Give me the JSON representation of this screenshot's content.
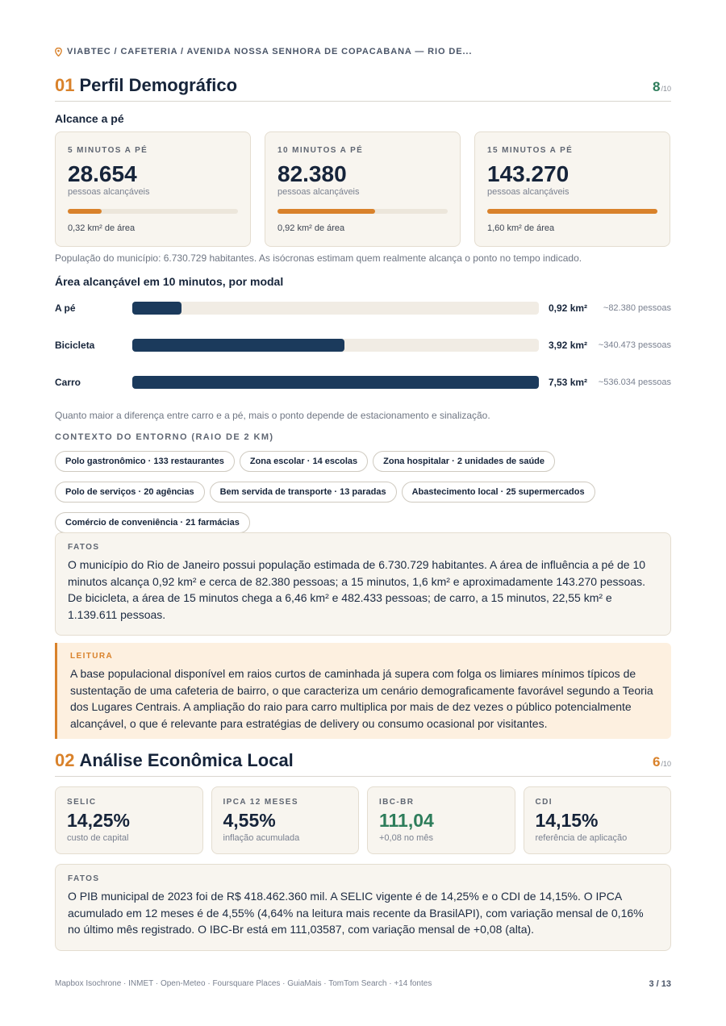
{
  "breadcrumb": "VIABTEC / CAFETERIA / AVENIDA NOSSA SENHORA DE COPACABANA — RIO DE...",
  "colors": {
    "accent": "#d9822b",
    "navy": "#1b3a5c",
    "green": "#2e7d5b"
  },
  "section1": {
    "number": "01",
    "title": "Perfil Demográfico",
    "score": "8",
    "score_den": "/10",
    "reach_title": "Alcance a pé",
    "reach_cards": [
      {
        "label": "5 MINUTOS A PÉ",
        "value": "28.654",
        "sub": "pessoas alcançáveis",
        "progress": 0.2,
        "area": "0,32 km² de área"
      },
      {
        "label": "10 MINUTOS A PÉ",
        "value": "82.380",
        "sub": "pessoas alcançáveis",
        "progress": 0.575,
        "area": "0,92 km² de área"
      },
      {
        "label": "15 MINUTOS A PÉ",
        "value": "143.270",
        "sub": "pessoas alcançáveis",
        "progress": 1.0,
        "area": "1,60 km² de área"
      }
    ],
    "population_note": "População do município: 6.730.729 habitantes. As isócronas estimam quem realmente alcança o ponto no tempo indicado.",
    "modal_title": "Área alcançável em 10 minutos, por modal",
    "modals": [
      {
        "label": "A pé",
        "value": "0,92 km²",
        "people": "~82.380 pessoas",
        "progress": 0.122
      },
      {
        "label": "Bicicleta",
        "value": "3,92 km²",
        "people": "~340.473 pessoas",
        "progress": 0.521
      },
      {
        "label": "Carro",
        "value": "7,53 km²",
        "people": "~536.034 pessoas",
        "progress": 1.0
      }
    ],
    "modal_note": "Quanto maior a diferença entre carro e a pé, mais o ponto depende de estacionamento e sinalização.",
    "context_title": "CONTEXTO DO ENTORNO (RAIO DE 2 KM)",
    "chips_row1": [
      "Polo gastronômico · 133 restaurantes",
      "Zona escolar · 14 escolas",
      "Zona hospitalar · 2 unidades de saúde"
    ],
    "chips_row2": [
      "Polo de serviços · 20 agências",
      "Bem servida de transporte · 13 paradas",
      "Abastecimento local · 25 supermercados"
    ],
    "chips_row3": [
      "Comércio de conveniência · 21 farmácias"
    ],
    "facts_label": "FATOS",
    "facts_text": "O município do Rio de Janeiro possui população estimada de 6.730.729 habitantes. A área de influência a pé de 10 minutos alcança 0,92 km² e cerca de 82.380 pessoas; a 15 minutos, 1,6 km² e aproximadamente 143.270 pessoas. De bicicleta, a área de 15 minutos chega a 6,46 km² e 482.433 pessoas; de carro, a 15 minutos, 22,55 km² e 1.139.611 pessoas.",
    "reading_label": "LEITURA",
    "reading_text": "A base populacional disponível em raios curtos de caminhada já supera com folga os limiares mínimos típicos de sustentação de uma cafeteria de bairro, o que caracteriza um cenário demograficamente favorável segundo a Teoria dos Lugares Centrais. A ampliação do raio para carro multiplica por mais de dez vezes o público potencialmente alcançável, o que é relevante para estratégias de delivery ou consumo ocasional por visitantes."
  },
  "section2": {
    "number": "02",
    "title": "Análise Econômica Local",
    "score": "6",
    "score_den": "/10",
    "kpis": [
      {
        "label": "SELIC",
        "value": "14,25%",
        "sub": "custo de capital"
      },
      {
        "label": "IPCA 12 MESES",
        "value": "4,55%",
        "sub": "inflação acumulada"
      },
      {
        "label": "IBC-BR",
        "value": "111,04",
        "sub": "+0,08 no mês"
      },
      {
        "label": "CDI",
        "value": "14,15%",
        "sub": "referência de aplicação"
      }
    ],
    "facts_label": "FATOS",
    "facts_text": "O PIB municipal de 2023 foi de R$ 418.462.360 mil. A SELIC vigente é de 14,25% e o CDI de 14,15%. O IPCA acumulado em 12 meses é de 4,55% (4,64% na leitura mais recente da BrasilAPI), com variação mensal de 0,16% no último mês registrado. O IBC-Br está em 111,03587, com variação mensal de +0,08 (alta)."
  },
  "footer": {
    "sources": "Mapbox Isochrone · INMET · Open-Meteo · Foursquare Places · GuiaMais · TomTom Search · +14 fontes",
    "page": "3 / 13"
  }
}
